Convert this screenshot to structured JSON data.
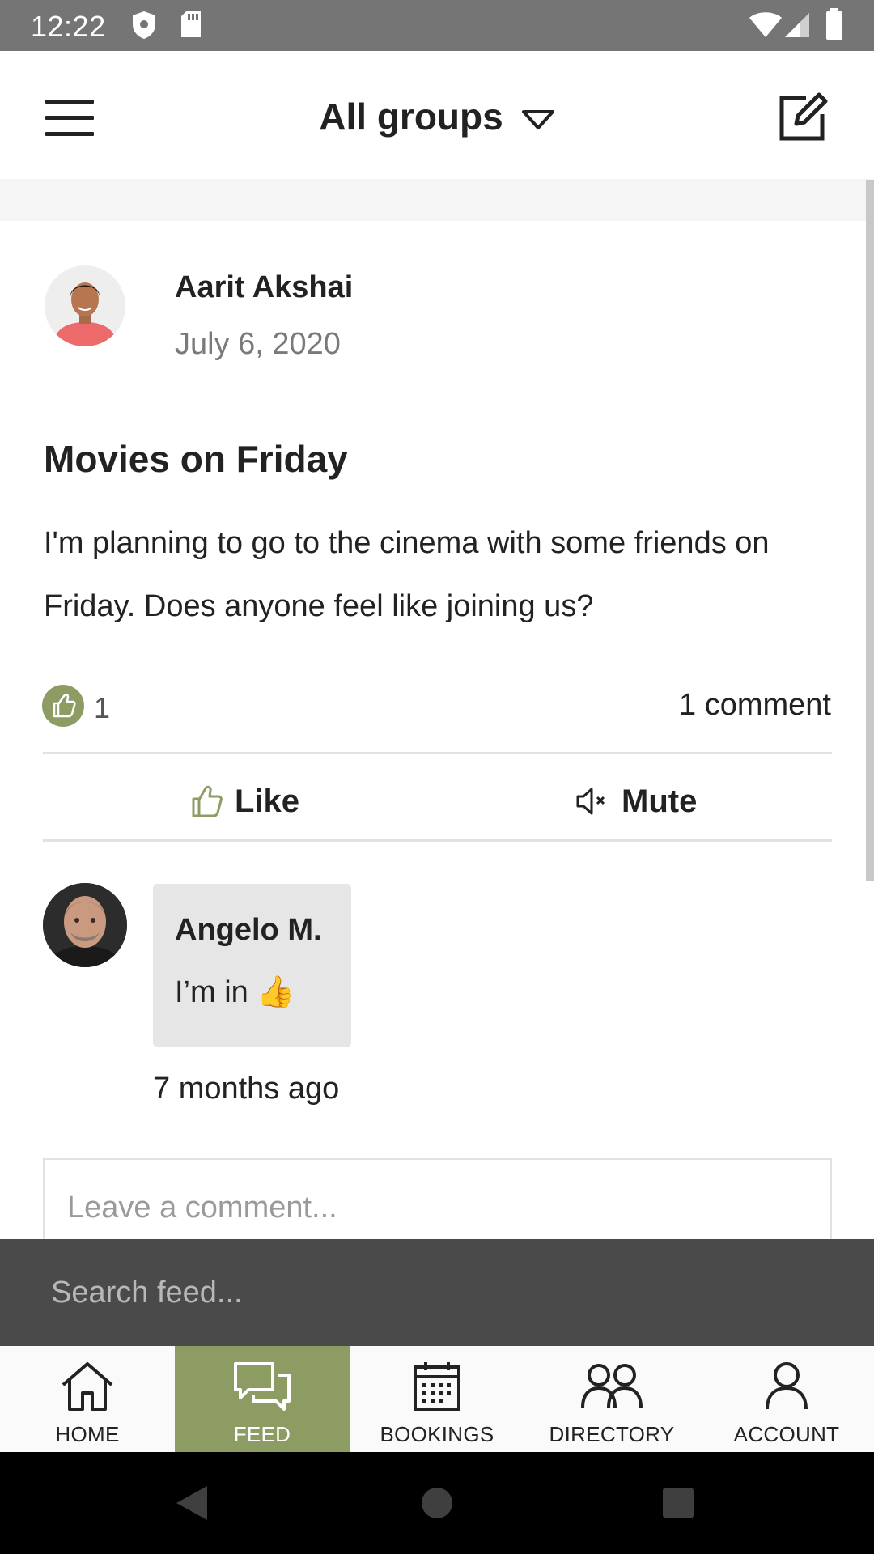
{
  "status_bar": {
    "time": "12:22",
    "icons": [
      "shield-icon",
      "sd-card-icon",
      "wifi-icon",
      "signal-icon",
      "battery-icon"
    ]
  },
  "header": {
    "title": "All groups",
    "menu_icon": "hamburger-menu-icon",
    "dropdown_icon": "chevron-down-icon",
    "compose_icon": "compose-icon"
  },
  "post": {
    "author": "Aarit Akshai",
    "date": "July 6, 2020",
    "title": "Movies on Friday",
    "body": "I'm planning to go to the cinema with some friends on Friday. Does anyone feel like joining us?",
    "like_count": "1",
    "comment_count": "1 comment",
    "actions": {
      "like_label": "Like",
      "mute_label": "Mute"
    }
  },
  "comment": {
    "author": "Angelo M.",
    "text": "I’m in 👍",
    "time": "7 months ago"
  },
  "comment_input": {
    "placeholder": "Leave a comment..."
  },
  "search": {
    "placeholder": "Search feed..."
  },
  "bottom_nav": {
    "items": [
      {
        "label": "HOME",
        "icon": "home-icon"
      },
      {
        "label": "FEED",
        "icon": "feed-icon",
        "active": true
      },
      {
        "label": "BOOKINGS",
        "icon": "calendar-icon"
      },
      {
        "label": "DIRECTORY",
        "icon": "people-icon"
      },
      {
        "label": "ACCOUNT",
        "icon": "person-icon"
      }
    ]
  },
  "colors": {
    "accent": "#8c9c63",
    "status_bar": "#757575",
    "search_bar": "#4a4a4a"
  }
}
